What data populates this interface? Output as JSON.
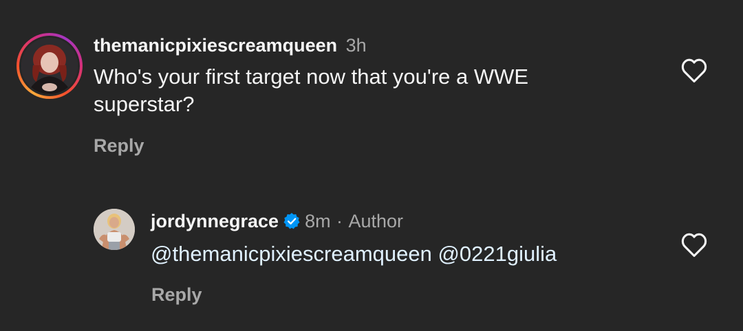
{
  "comments": [
    {
      "username": "themanicpixiescreamqueen",
      "time": "3h",
      "text_line1": "Who's your first target now that you're a WWE",
      "text_line2": "superstar?",
      "reply_label": "Reply"
    }
  ],
  "replies": [
    {
      "username": "jordynnegrace",
      "verified": true,
      "time": "8m",
      "separator": "·",
      "role": "Author",
      "text": "@themanicpixiescreamqueen @0221giulia",
      "reply_label": "Reply"
    }
  ],
  "colors": {
    "background": "#262626",
    "text_primary": "#f5f5f5",
    "text_secondary": "#a8a8a8",
    "mention": "#e0f1ff",
    "verified_badge": "#0095f6",
    "story_ring_start": "#f9a93b",
    "story_ring_end": "#a436c2"
  },
  "icons": {
    "like": "heart-outline-icon",
    "verified": "verified-badge-icon"
  }
}
